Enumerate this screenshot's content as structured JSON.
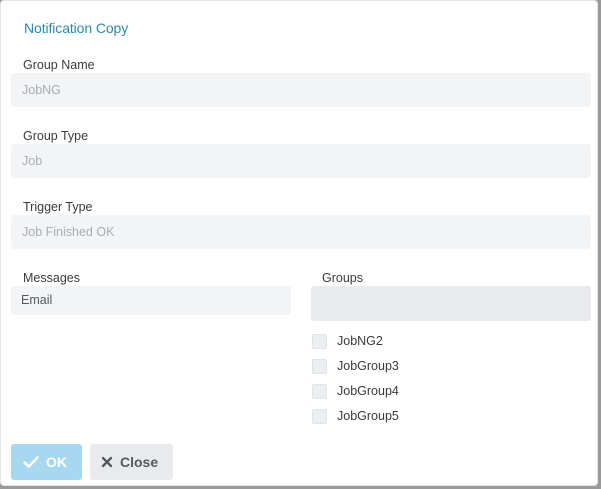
{
  "dialog": {
    "title": "Notification Copy"
  },
  "form": {
    "group_name": {
      "label": "Group Name",
      "value": "JobNG"
    },
    "group_type": {
      "label": "Group Type",
      "value": "Job"
    },
    "trigger_type": {
      "label": "Trigger Type",
      "value": "Job Finished OK"
    },
    "messages": {
      "label": "Messages",
      "value": "Email"
    },
    "groups": {
      "label": "Groups",
      "options": [
        {
          "label": "JobNG2",
          "checked": false
        },
        {
          "label": "JobGroup3",
          "checked": false
        },
        {
          "label": "JobGroup4",
          "checked": false
        },
        {
          "label": "JobGroup5",
          "checked": false
        }
      ]
    }
  },
  "buttons": {
    "ok_label": "OK",
    "close_label": "Close"
  },
  "colors": {
    "title": "#2a88b3",
    "ok_button": "#a6d8f0",
    "close_button": "#e8eaee",
    "field_bg": "#f3f4f6"
  },
  "icons": {
    "ok": "check-icon",
    "close": "x-icon"
  }
}
